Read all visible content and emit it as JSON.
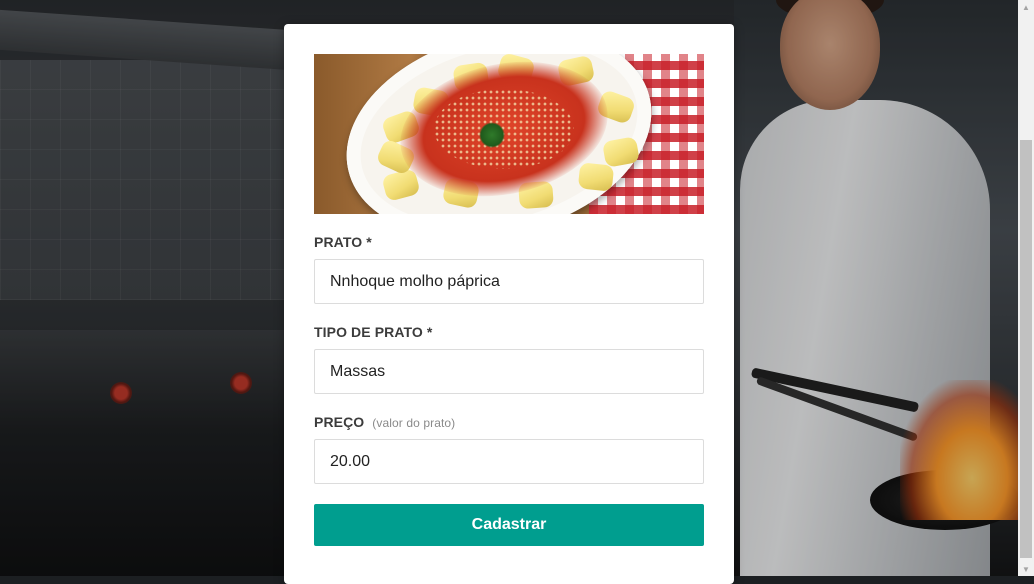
{
  "form": {
    "image_alt": "gnocchi-with-tomato-sauce",
    "dish_label": "PRATO *",
    "dish_value": "Nnhoque molho páprica",
    "type_label": "TIPO DE PRATO *",
    "type_value": "Massas",
    "price_label": "PREÇO",
    "price_hint": "(valor do prato)",
    "price_value": "20.00",
    "submit_label": "Cadastrar"
  },
  "colors": {
    "accent": "#009e8f",
    "card": "#ffffff",
    "label_text": "#3c3c3c",
    "hint_text": "#8a8a8a"
  },
  "icons": {
    "scroll_up": "triangle-up-icon",
    "scroll_down": "triangle-down-icon"
  }
}
